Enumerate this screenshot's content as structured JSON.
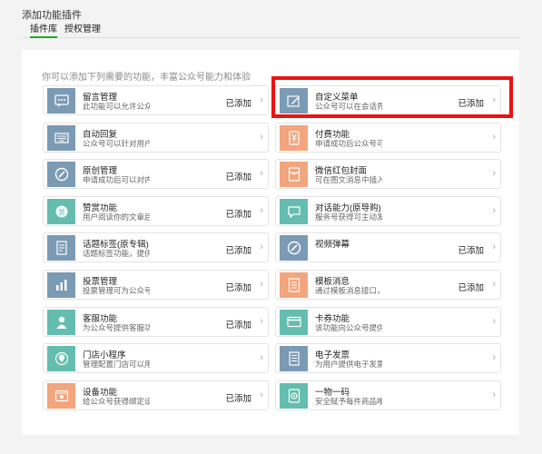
{
  "header": {
    "title": "添加功能插件",
    "tabs": [
      {
        "label": "插件库",
        "active": true
      },
      {
        "label": "授权管理",
        "active": false
      }
    ]
  },
  "main": {
    "intro": "你可以添加下列需要的功能，丰富公众号能力和体验",
    "plugins": [
      {
        "name": "留言管理",
        "desc": "此功能可以允许公众号对发布的文章开启留言",
        "status": "已添加",
        "icon": "chat-bubble-icon",
        "color": "blue"
      },
      {
        "name": "自定义菜单",
        "desc": "公众号可以在会话界面底部设置自定义菜单",
        "status": "已添加",
        "icon": "pencil-square-icon",
        "color": "blue"
      },
      {
        "name": "自动回复",
        "desc": "公众号可以针对用户的行为设置自动回复",
        "status": "",
        "icon": "keyboard-icon",
        "color": "blue"
      },
      {
        "name": "付费功能",
        "desc": "申请成功后公众号可以发表付费内容",
        "status": "",
        "icon": "money-icon",
        "color": "orange"
      },
      {
        "name": "原创管理",
        "desc": "申请成功后可以对内容进行原创声明",
        "status": "已添加",
        "icon": "slash-circle-icon",
        "color": "blue"
      },
      {
        "name": "微信红包封面",
        "desc": "可在图文消息中插入红包封面",
        "status": "",
        "icon": "red-envelope-icon",
        "color": "orange"
      },
      {
        "name": "赞赏功能",
        "desc": "用户阅读你的文章后可以进行赞赏",
        "status": "已添加",
        "icon": "coin-icon",
        "color": "green"
      },
      {
        "name": "对话能力(原导购)",
        "desc": "服务号获得可主动发起对话的能力",
        "status": "",
        "icon": "dialog-icon",
        "color": "green"
      },
      {
        "name": "话题标签(原专辑)",
        "desc": "话题标签功能，提供给公众号内容归类使用",
        "status": "已添加",
        "icon": "document-icon",
        "color": "blue"
      },
      {
        "name": "视频弹幕",
        "desc": "",
        "status": "已添加",
        "icon": "slash-circle-icon",
        "color": "blue"
      },
      {
        "name": "投票管理",
        "desc": "投票管理可为公众号发起投票活动",
        "status": "已添加",
        "icon": "bar-chart-icon",
        "color": "blue"
      },
      {
        "name": "模板消息",
        "desc": "通过模板消息接口，公众号能够向关注其账号的用户发送消息",
        "status": "已添加",
        "icon": "message-template-icon",
        "color": "orange"
      },
      {
        "name": "客服功能",
        "desc": "为公众号提供客服功能，支持多人同时为用户服务",
        "status": "已添加",
        "icon": "user-icon",
        "color": "green"
      },
      {
        "name": "卡券功能",
        "desc": "该功能向公众号提供卡券管理、推广、经营分析",
        "status": "",
        "icon": "card-icon",
        "color": "green"
      },
      {
        "name": "门店小程序",
        "desc": "管理配置门店可以用于卡券、广告、WIFI",
        "status": "",
        "icon": "location-pin-icon",
        "color": "green"
      },
      {
        "name": "电子发票",
        "desc": "为用户提供电子发票的标准化接入流程，开票报销更便捷",
        "status": "",
        "icon": "invoice-icon",
        "color": "blue"
      },
      {
        "name": "设备功能",
        "desc": "给公众号获得绑定设备的能力",
        "status": "已添加",
        "icon": "device-icon",
        "color": "orange"
      },
      {
        "name": "一物一码",
        "desc": "安全赋予每件商品唯一码，连接商品与用户",
        "status": "",
        "icon": "qrcode-icon",
        "color": "green"
      }
    ]
  },
  "colors": {
    "accent": "#1aad19",
    "highlight": "#ee1111",
    "blue": "#7b9ab4",
    "green": "#64bdae",
    "orange": "#f3a57d"
  }
}
